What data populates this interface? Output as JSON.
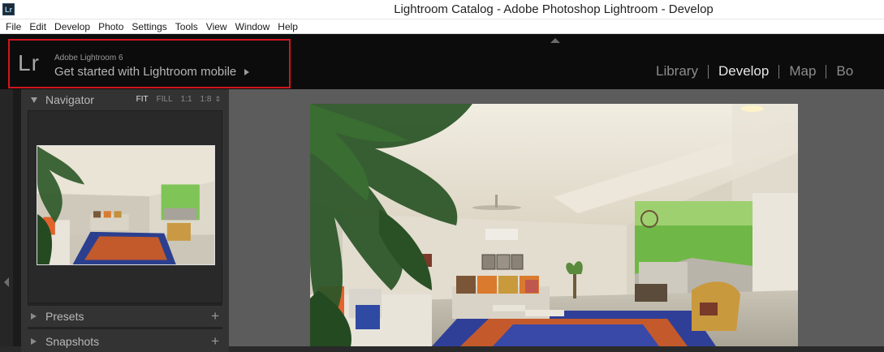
{
  "window": {
    "app_icon": "Lr",
    "title": "Lightroom Catalog - Adobe Photoshop Lightroom - Develop"
  },
  "menu": [
    "File",
    "Edit",
    "Develop",
    "Photo",
    "Settings",
    "Tools",
    "View",
    "Window",
    "Help"
  ],
  "identity": {
    "logo": "Lr",
    "product": "Adobe Lightroom 6",
    "tagline": "Get started with Lightroom mobile",
    "highlight_color": "#d0161f"
  },
  "modules": {
    "items": [
      "Library",
      "Develop",
      "Map",
      "Bo"
    ],
    "active": "Develop"
  },
  "left_panel": {
    "navigator": {
      "title": "Navigator",
      "zoom_options": [
        "FIT",
        "FILL",
        "1:1",
        "1:8"
      ],
      "active_zoom": "FIT",
      "zoom_stepper_icon": "⇕"
    },
    "presets": {
      "title": "Presets",
      "add_icon": "+"
    },
    "snapshots": {
      "title": "Snapshots",
      "add_icon": "+"
    }
  },
  "icons": {
    "top_panel_toggle": "triangle-up-icon",
    "left_panel_toggle": "triangle-left-icon",
    "expand": "disclosure-triangle-icon"
  }
}
